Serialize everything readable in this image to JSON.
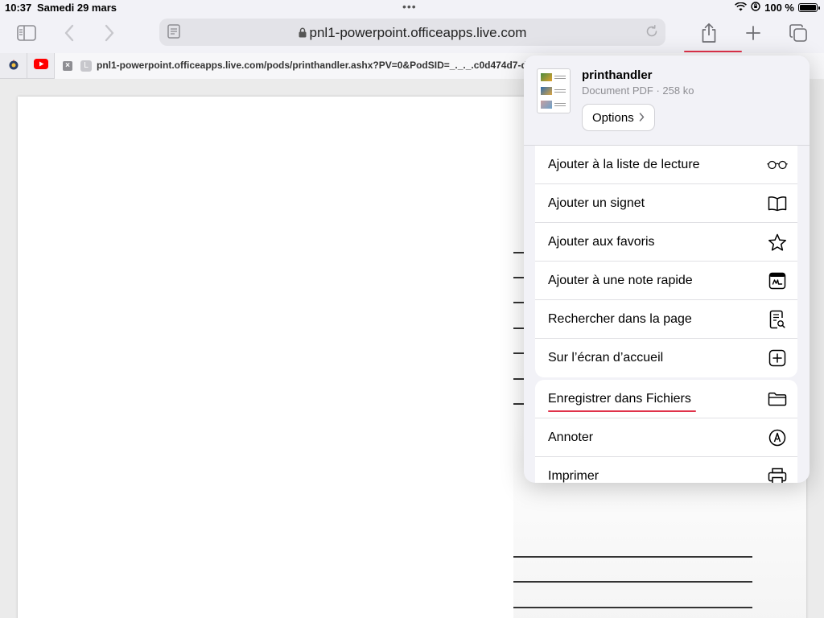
{
  "status_bar": {
    "time": "10:37",
    "date": "Samedi 29 mars",
    "dots": "•••",
    "battery_text": "100 %",
    "battery_level": 1.0
  },
  "toolbar": {
    "address": "pnl1-powerpoint.officeapps.live.com",
    "icons": [
      "sidebar-icon",
      "back-icon",
      "forward-icon",
      "reader-icon",
      "lock-icon",
      "reload-icon",
      "share-icon",
      "plus-icon",
      "tabs-icon"
    ],
    "accent_color": "#e0324a"
  },
  "tabs_bar": {
    "close_glyph": "×",
    "favicon_letter": "L",
    "active_tab_title": "pnl1-powerpoint.officeapps.live.com/pods/printhandler.ashx?PV=0&PodSID=_._._.c0d474d7-d"
  },
  "share_sheet": {
    "document_name": "printhandler",
    "document_meta": "Document PDF · 258 ko",
    "options_label": "Options",
    "group1": [
      {
        "label": "Ajouter à la liste de lecture",
        "icon": "glasses-icon"
      },
      {
        "label": "Ajouter un signet",
        "icon": "book-icon"
      },
      {
        "label": "Ajouter aux favoris",
        "icon": "star-icon"
      },
      {
        "label": "Ajouter à une note rapide",
        "icon": "quick-note-icon"
      },
      {
        "label": "Rechercher dans la page",
        "icon": "find-in-page-icon"
      },
      {
        "label": "Sur l’écran d’accueil",
        "icon": "add-square-icon"
      }
    ],
    "group2": [
      {
        "label": "Enregistrer dans Fichiers",
        "icon": "folder-icon"
      },
      {
        "label": "Annoter",
        "icon": "markup-icon"
      },
      {
        "label": "Imprimer",
        "icon": "printer-icon"
      }
    ]
  }
}
